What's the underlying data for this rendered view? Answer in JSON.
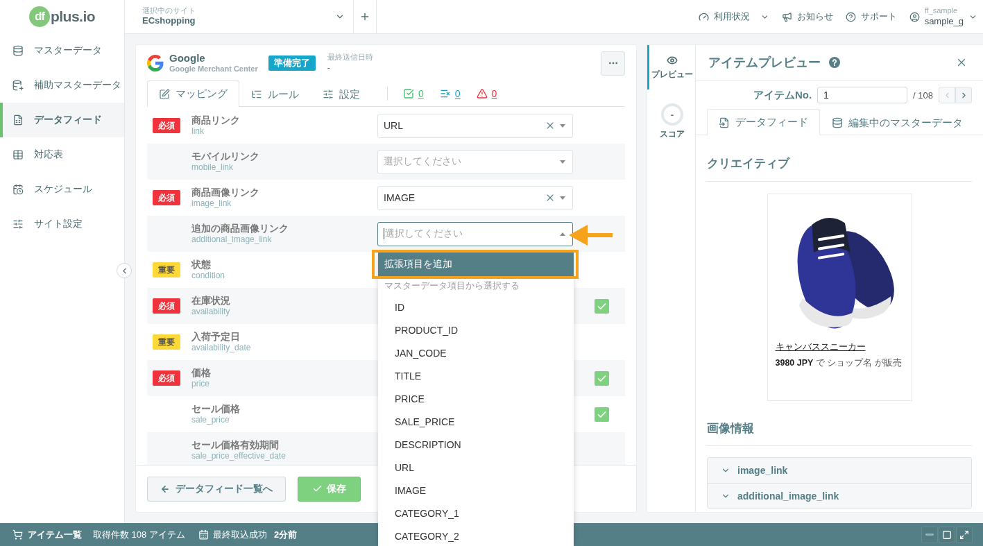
{
  "sidebar": {
    "logo": {
      "mark": "df",
      "text": "plus.io"
    },
    "items": [
      {
        "label": "マスターデータ",
        "selected": false
      },
      {
        "label": "補助マスターデータ",
        "selected": false
      },
      {
        "label": "データフィード",
        "selected": true
      },
      {
        "label": "対応表",
        "selected": false
      },
      {
        "label": "スケジュール",
        "selected": false
      },
      {
        "label": "サイト設定",
        "selected": false
      }
    ]
  },
  "header": {
    "site_selector": {
      "label": "選択中のサイト",
      "value": "ECshopping"
    },
    "menu": [
      {
        "label": "利用状況",
        "dropdown": true
      },
      {
        "label": "お知らせ",
        "dropdown": false
      },
      {
        "label": "サポート",
        "dropdown": false
      }
    ],
    "user": {
      "account": "ff_sample",
      "name": "sample_g"
    }
  },
  "feed_card": {
    "channel": {
      "name": "Google",
      "subtitle": "Google Merchant Center"
    },
    "status_badge": "準備完了",
    "last_sent": {
      "label": "最終送信日時",
      "value": "-"
    },
    "tabs": [
      {
        "label": "マッピング",
        "selected": true
      },
      {
        "label": "ルール",
        "selected": false
      },
      {
        "label": "設定",
        "selected": false
      }
    ],
    "counters": [
      {
        "kind": "ok",
        "count": "0"
      },
      {
        "kind": "filtered",
        "count": "0"
      },
      {
        "kind": "warning",
        "count": "0"
      }
    ],
    "rows": [
      {
        "badge": {
          "kind": "required",
          "label": "必須"
        },
        "label": "商品リンク",
        "field": "link",
        "select": {
          "value": "URL",
          "clearable": true
        },
        "checked": false
      },
      {
        "label": "モバイルリンク",
        "field": "mobile_link",
        "select": {
          "placeholder": "選択してください"
        },
        "checked": false
      },
      {
        "badge": {
          "kind": "required",
          "label": "必須"
        },
        "label": "商品画像リンク",
        "field": "image_link",
        "select": {
          "value": "IMAGE",
          "clearable": true
        },
        "checked": false
      },
      {
        "label": "追加の商品画像リンク",
        "field": "additional_image_link",
        "select": {
          "placeholder": "選択してください",
          "open": true,
          "menu": {
            "action": {
              "label": "拡張項目を追加",
              "highlighted": true
            },
            "group_label": "マスターデータ項目から選択する",
            "options": [
              {
                "label": "ID",
                "selected": false
              },
              {
                "label": "PRODUCT_ID",
                "selected": false
              },
              {
                "label": "JAN_CODE",
                "selected": false
              },
              {
                "label": "TITLE",
                "selected": false
              },
              {
                "label": "PRICE",
                "selected": false
              },
              {
                "label": "SALE_PRICE",
                "selected": false
              },
              {
                "label": "DESCRIPTION",
                "selected": false
              },
              {
                "label": "URL",
                "selected": false
              },
              {
                "label": "IMAGE",
                "selected": false
              },
              {
                "label": "CATEGORY_1",
                "selected": false
              },
              {
                "label": "CATEGORY_2",
                "selected": false
              }
            ]
          }
        },
        "checked": false
      },
      {
        "badge": {
          "kind": "important",
          "label": "重要"
        },
        "label": "状態",
        "field": "condition",
        "checked": false
      },
      {
        "badge": {
          "kind": "required",
          "label": "必須"
        },
        "label": "在庫状況",
        "field": "availability",
        "checked": true
      },
      {
        "badge": {
          "kind": "important",
          "label": "重要"
        },
        "label": "入荷予定日",
        "field": "availability_date",
        "checked": false
      },
      {
        "badge": {
          "kind": "required",
          "label": "必須"
        },
        "label": "価格",
        "field": "price",
        "checked": true
      },
      {
        "label": "セール価格",
        "field": "sale_price",
        "checked": true
      },
      {
        "label": "セール価格有効期間",
        "field": "sale_price_effective_date",
        "checked": false
      }
    ],
    "footer": {
      "back_button": "データフィード一覧へ",
      "save_button": "保存"
    }
  },
  "preview_panel": {
    "side_tabs": [
      {
        "kind": "preview",
        "label": "プレビュー",
        "selected": true
      },
      {
        "kind": "score",
        "label": "スコア",
        "value": "-",
        "selected": false
      }
    ],
    "title": "アイテムプレビュー",
    "item_no": {
      "label": "アイテムNo.",
      "value": "1",
      "total": "/ 108",
      "prev_disabled": true,
      "next_disabled": false
    },
    "tabs": [
      {
        "label": "データフィード",
        "selected": true
      },
      {
        "label": "編集中のマスターデータ",
        "selected": false
      }
    ],
    "creative": {
      "heading": "クリエイティブ",
      "product_name": "キャンバススニーカー",
      "sale_text": "**3980 JPY** で ショップ名 が販売"
    },
    "image_info": {
      "heading": "画像情報",
      "items": [
        {
          "label": "image_link",
          "expanded": false
        },
        {
          "label": "additional_image_link",
          "expanded": false
        }
      ]
    }
  },
  "status_bar": {
    "items_link": "アイテム一覧",
    "count_text": "取得件数 108 アイテム",
    "last_import": {
      "label": "最終取込成功",
      "value": "2分前"
    },
    "window_buttons": [
      {
        "kind": "minimize",
        "disabled": true
      },
      {
        "kind": "restore",
        "disabled": false
      },
      {
        "kind": "expand",
        "disabled": false
      }
    ]
  }
}
